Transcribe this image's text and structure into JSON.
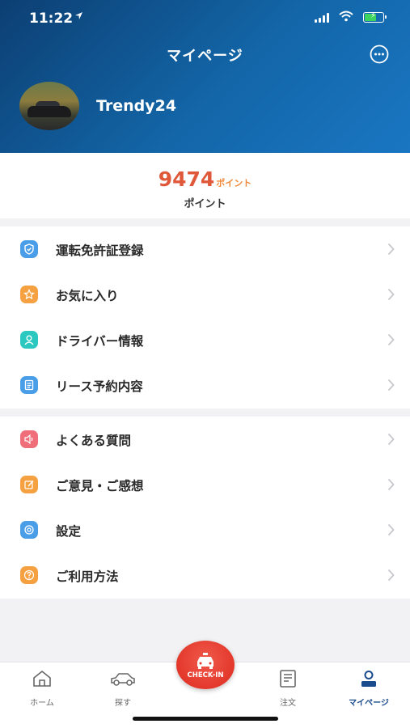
{
  "status_bar": {
    "time": "11:22"
  },
  "header": {
    "title": "マイページ"
  },
  "profile": {
    "username": "Trendy24"
  },
  "points": {
    "value": "9474",
    "unit": "ポイント",
    "label": "ポイント"
  },
  "menu_group_1": [
    {
      "label": "運転免許証登録",
      "icon": "license-icon",
      "color": "#4a9ee8"
    },
    {
      "label": "お気に入り",
      "icon": "star-icon",
      "color": "#f5a142"
    },
    {
      "label": "ドライバー情報",
      "icon": "driver-icon",
      "color": "#2bc8c0"
    },
    {
      "label": "リース予約内容",
      "icon": "document-icon",
      "color": "#4a9ee8"
    }
  ],
  "menu_group_2": [
    {
      "label": "よくある質問",
      "icon": "faq-icon",
      "color": "#f06e7a"
    },
    {
      "label": "ご意見・ご感想",
      "icon": "feedback-icon",
      "color": "#f5a142"
    },
    {
      "label": "設定",
      "icon": "settings-icon",
      "color": "#4a9ee8"
    },
    {
      "label": "ご利用方法",
      "icon": "help-icon",
      "color": "#f5a142"
    }
  ],
  "tabbar": {
    "home": "ホーム",
    "search": "探す",
    "checkin": "CHECK-IN",
    "orders": "注文",
    "mypage": "マイページ",
    "active_color": "#1a4b8c"
  }
}
